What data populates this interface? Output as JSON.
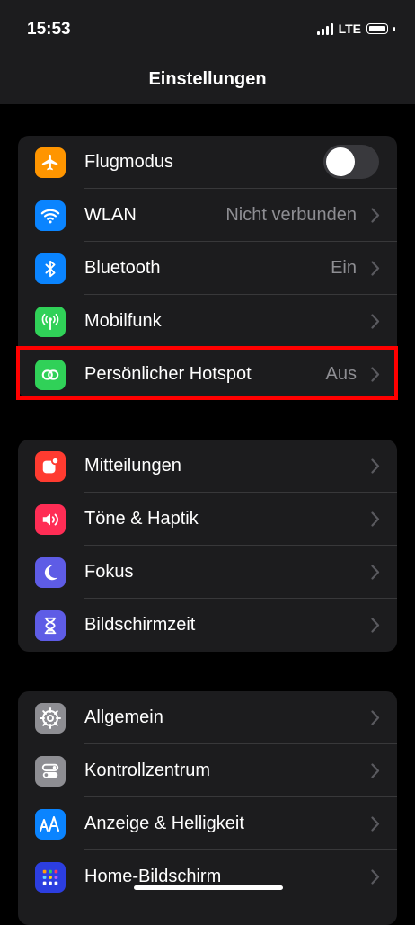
{
  "status": {
    "time": "15:53",
    "network": "LTE"
  },
  "nav": {
    "title": "Einstellungen"
  },
  "groups": [
    {
      "rows": [
        {
          "label": "Flugmodus",
          "icon": "airplane-icon",
          "icon_color": "#ff9500",
          "toggle": false
        },
        {
          "label": "WLAN",
          "value": "Nicht verbunden",
          "icon": "wifi-icon",
          "icon_color": "#0a84ff"
        },
        {
          "label": "Bluetooth",
          "value": "Ein",
          "icon": "bluetooth-icon",
          "icon_color": "#0a84ff"
        },
        {
          "label": "Mobilfunk",
          "icon": "antenna-icon",
          "icon_color": "#30d158"
        },
        {
          "label": "Persönlicher Hotspot",
          "value": "Aus",
          "icon": "hotspot-icon",
          "icon_color": "#30d158"
        }
      ]
    },
    {
      "rows": [
        {
          "label": "Mitteilungen",
          "icon": "notifications-icon",
          "icon_color": "#ff3b30"
        },
        {
          "label": "Töne & Haptik",
          "icon": "speaker-icon",
          "icon_color": "#ff2d55"
        },
        {
          "label": "Fokus",
          "icon": "moon-icon",
          "icon_color": "#5e5ce6"
        },
        {
          "label": "Bildschirmzeit",
          "icon": "hourglass-icon",
          "icon_color": "#5e5ce6"
        }
      ]
    },
    {
      "rows": [
        {
          "label": "Allgemein",
          "icon": "gear-icon",
          "icon_color": "#8e8e93"
        },
        {
          "label": "Kontrollzentrum",
          "icon": "switches-icon",
          "icon_color": "#8e8e93"
        },
        {
          "label": "Anzeige & Helligkeit",
          "icon": "text-size-icon",
          "icon_color": "#0a84ff"
        },
        {
          "label": "Home-Bildschirm",
          "icon": "home-grid-icon",
          "icon_color": "#2c3ee0"
        }
      ]
    }
  ]
}
